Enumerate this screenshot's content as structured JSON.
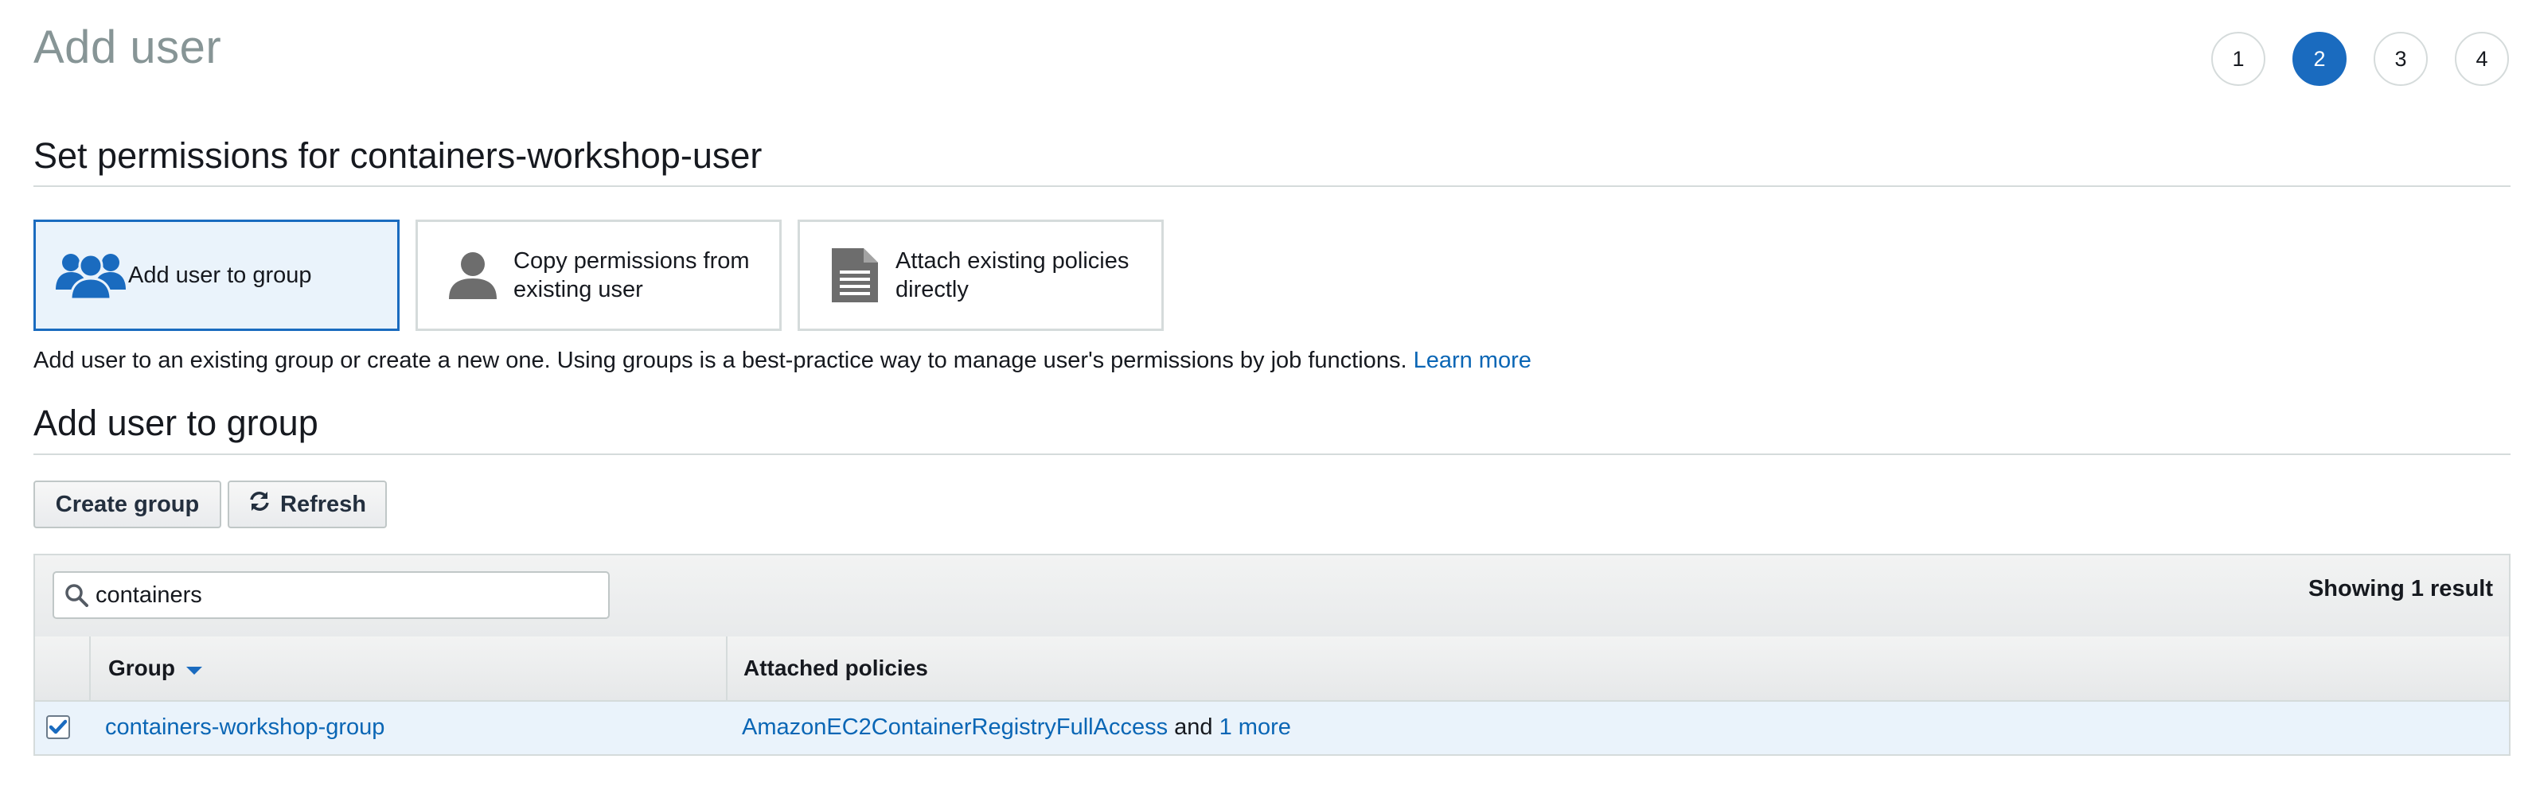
{
  "page": {
    "title": "Add user",
    "steps": [
      "1",
      "2",
      "3",
      "4"
    ],
    "active_step": "2"
  },
  "permissions": {
    "heading": "Set permissions for containers-workshop-user",
    "options": [
      {
        "label": "Add user to group",
        "icon": "user-group-icon",
        "selected": true
      },
      {
        "label": "Copy permissions from existing user",
        "icon": "user-icon",
        "selected": false
      },
      {
        "label": "Attach existing policies directly",
        "icon": "document-icon",
        "selected": false
      }
    ],
    "description": "Add user to an existing group or create a new one. Using groups is a best-practice way to manage user's permissions by job functions.",
    "learn_more": "Learn more"
  },
  "group_section": {
    "heading": "Add user to group",
    "create_button": "Create group",
    "refresh_button": "Refresh",
    "search_value": "containers",
    "result_count": "Showing 1 result",
    "columns": [
      "Group",
      "Attached policies"
    ],
    "rows": [
      {
        "checked": true,
        "group": "containers-workshop-group",
        "policy": "AmazonEC2ContainerRegistryFullAccess",
        "policy_joiner": "and",
        "more": "1 more"
      }
    ]
  },
  "colors": {
    "accent": "#1a6bbf",
    "link": "#0a66b5",
    "selected_bg": "#eaf3fb",
    "title_gray": "#879596"
  }
}
